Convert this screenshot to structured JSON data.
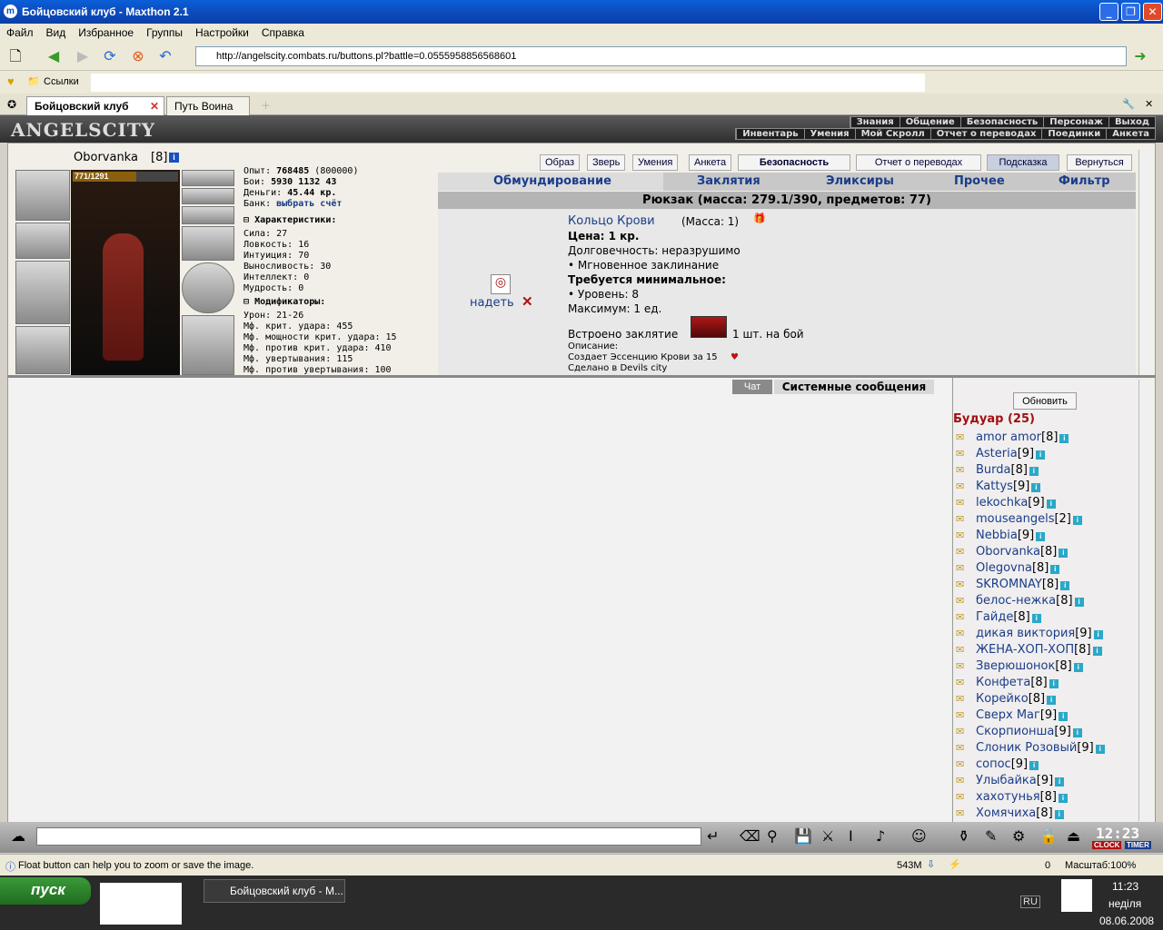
{
  "window": {
    "title": "Бойцовский клуб - Maxthon 2.1",
    "app_icon": "maxthon-icon"
  },
  "menu": [
    "Файл",
    "Вид",
    "Избранное",
    "Группы",
    "Настройки",
    "Справка"
  ],
  "address": {
    "url": "http://angelscity.combats.ru/buttons.pl?battle=0.0555958856568601"
  },
  "links_label": "Ссылки",
  "tabs": [
    {
      "label": "Бойцовский клуб",
      "active": true
    },
    {
      "label": "Путь Воина",
      "active": false
    }
  ],
  "game": {
    "logo": "ANGELSCITY",
    "nav_top": [
      "Знания",
      "Общение",
      "Безопасность",
      "Персонаж",
      "Выход"
    ],
    "nav_bottom": [
      "Инвентарь",
      "Умения",
      "Мой Скролл",
      "Отчет о переводах",
      "Поединки",
      "Анкета"
    ],
    "top_buttons": [
      "Образ",
      "Зверь",
      "Умения",
      "Анкета",
      "Безопасность",
      "Отчет о переводах",
      "Подсказка",
      "Вернуться"
    ],
    "character": {
      "name": "Oborvanka",
      "level": "[8]",
      "hp": "771/1291"
    },
    "stats": {
      "exp_label": "Опыт:",
      "exp": "768485",
      "exp_next": "(800000)",
      "fights_label": "Бои:",
      "wins": "5930",
      "losses": "1132",
      "draws": "43",
      "money_label": "Деньги:",
      "money": "45.44 кр.",
      "bank_label": "Банк:",
      "bank_link": "выбрать счёт",
      "chars_title": "Характеристики:",
      "attrs": [
        "Сила: 27",
        "Ловкость: 16",
        "Интуиция: 70",
        "Выносливость: 30",
        "Интеллект: 0",
        "Мудрость: 0"
      ],
      "mods_title": "Модификаторы:",
      "mods": [
        "Урон: 21-26",
        "Мф. крит. удара: 455",
        "Мф. мощности крит. удара: 15",
        "Мф. против крит. удара: 410",
        "Мф. увертывания: 115",
        "Мф. против увертывания: 100"
      ]
    },
    "inv_tabs": [
      "Обмундирование",
      "Заклятия",
      "Эликсиры",
      "Прочее",
      "Фильтр"
    ],
    "backpack": "Рюкзак (масса: 279.1/390, предметов: 77)",
    "item": {
      "name": "Кольцо Крови",
      "mass": "(Масса: 1)",
      "price": "Цена: 1 кр.",
      "durability": "Долговечность: неразрушимо",
      "instant": "• Мгновенное заклинание",
      "req_title": "Требуется минимальное:",
      "req_level": "• Уровень: 8",
      "max": "Максимум: 1 ед.",
      "spell_label": "Встроено заклятие",
      "spell_count": "1 шт. на бой",
      "desc_label": "Описание:",
      "desc": "Создает Эссенцию Крови за 15",
      "made": "Сделано в Devils city",
      "equip": "надеть"
    },
    "chat_tabs": [
      "Чат",
      "Системные сообщения"
    ],
    "refresh": "Обновить",
    "room": "Будуар (25)",
    "users": [
      {
        "name": "amor amor",
        "level": "[8]"
      },
      {
        "name": "Asteria",
        "level": "[9]"
      },
      {
        "name": "Burda",
        "level": "[8]"
      },
      {
        "name": "Kattys",
        "level": "[9]"
      },
      {
        "name": "lekochka",
        "level": "[9]"
      },
      {
        "name": "mouseangels",
        "level": "[2]"
      },
      {
        "name": "Nebbia",
        "level": "[9]"
      },
      {
        "name": "Oborvanka",
        "level": "[8]"
      },
      {
        "name": "Olegovna",
        "level": "[8]"
      },
      {
        "name": "SKROMNAY",
        "level": "[8]"
      },
      {
        "name": "белос-нежка",
        "level": "[8]"
      },
      {
        "name": "Гайде",
        "level": "[8]"
      },
      {
        "name": "дикая виктория",
        "level": "[9]"
      },
      {
        "name": "ЖЕНА-ХОП-ХОП",
        "level": "[8]"
      },
      {
        "name": "Зверюшонок",
        "level": "[8]"
      },
      {
        "name": "Конфета",
        "level": "[8]"
      },
      {
        "name": "Корейко",
        "level": "[8]"
      },
      {
        "name": "Сверх Маг",
        "level": "[9]"
      },
      {
        "name": "Скорпионша",
        "level": "[9]"
      },
      {
        "name": "Слоник Розовый",
        "level": "[9]"
      },
      {
        "name": "сопос",
        "level": "[9]"
      },
      {
        "name": "Улыбайка",
        "level": "[9]"
      },
      {
        "name": "хахотунья",
        "level": "[8]"
      },
      {
        "name": "Хомячиха",
        "level": "[8]"
      }
    ],
    "clock": "12:23",
    "clock_labels": [
      "CLOCK",
      "TIMER"
    ]
  },
  "status": {
    "text": "Float button can help you to zoom or save the image.",
    "memory": "543M",
    "popups": "0",
    "zoom": "Масштаб:100%"
  },
  "taskbar": {
    "start": "пуск",
    "task": "Бойцовский клуб - M...",
    "lang": "RU",
    "time": "11:23",
    "day": "неділя",
    "date": "08.06.2008"
  }
}
